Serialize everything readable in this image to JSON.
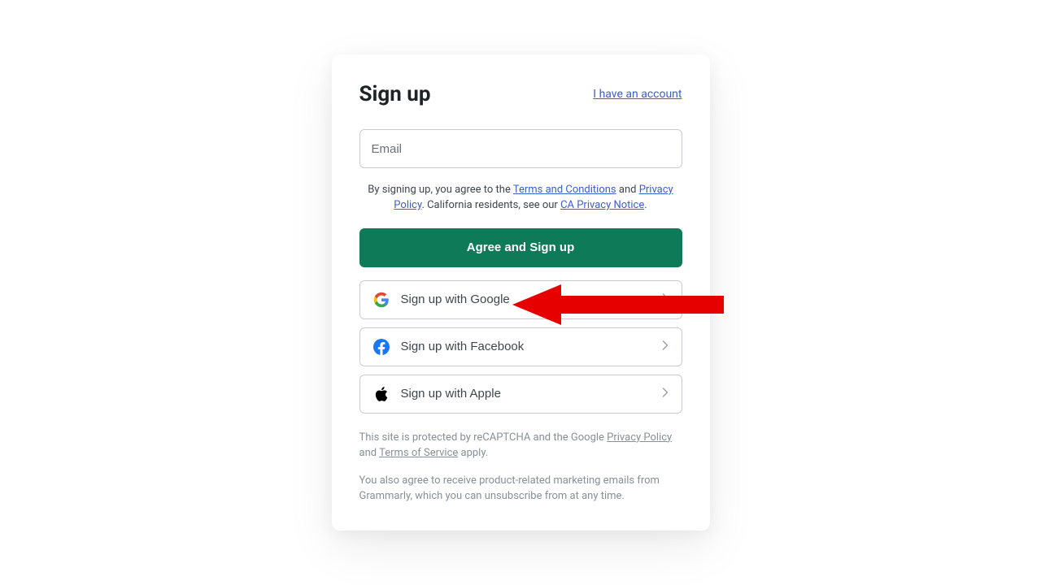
{
  "header": {
    "title": "Sign up",
    "have_account_link": "I have an account"
  },
  "email_input": {
    "placeholder": "Email"
  },
  "consent": {
    "part1": "By signing up, you agree to the ",
    "terms_link": "Terms and Conditions",
    "part2": " and ",
    "privacy_link": "Privacy Policy",
    "part3": ". California residents, see our ",
    "ca_link": "CA Privacy Notice",
    "part4": "."
  },
  "primary_button": "Agree and Sign up",
  "providers": {
    "google": "Sign up with Google",
    "facebook": "Sign up with Facebook",
    "apple": "Sign up with Apple"
  },
  "recaptcha": {
    "part1": "This site is protected by reCAPTCHA and the Google ",
    "privacy_link": "Privacy Policy",
    "part2": " and ",
    "terms_link": "Terms of Service",
    "part3": " apply."
  },
  "marketing_text": "You also agree to receive product-related marketing emails from Grammarly, which you can unsubscribe from at any time."
}
